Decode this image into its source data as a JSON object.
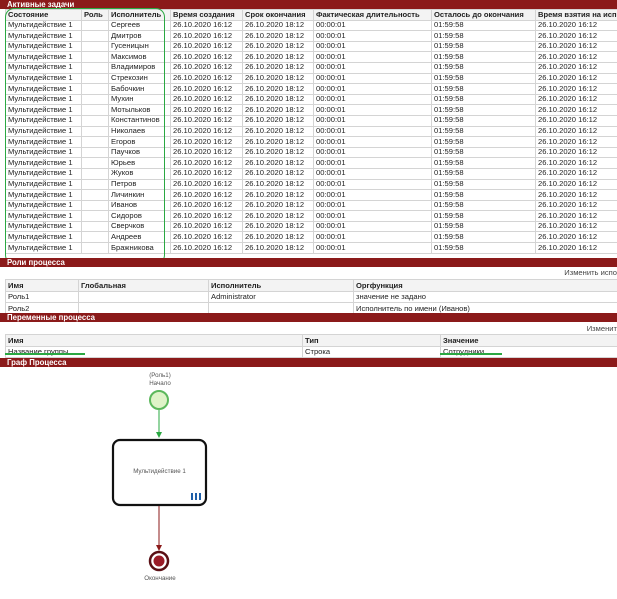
{
  "tasks": {
    "section_title": "Активные задачи",
    "headers": [
      "Состояние",
      "Роль",
      "Исполнитель",
      "Время создания",
      "Срок окончания",
      "Фактическая длительность",
      "Осталось до окончания",
      "Время взятия на испол"
    ],
    "rows": [
      [
        "Мультидействие 1",
        "",
        "Сергеев",
        "26.10.2020 16:12",
        "26.10.2020 18:12",
        "00:00:01",
        "01:59:58",
        "26.10.2020 16:12"
      ],
      [
        "Мультидействие 1",
        "",
        "Дмитров",
        "26.10.2020 16:12",
        "26.10.2020 18:12",
        "00:00:01",
        "01:59:58",
        "26.10.2020 16:12"
      ],
      [
        "Мультидействие 1",
        "",
        "Гусеницын",
        "26.10.2020 16:12",
        "26.10.2020 18:12",
        "00:00:01",
        "01:59:58",
        "26.10.2020 16:12"
      ],
      [
        "Мультидействие 1",
        "",
        "Максимов",
        "26.10.2020 16:12",
        "26.10.2020 18:12",
        "00:00:01",
        "01:59:58",
        "26.10.2020 16:12"
      ],
      [
        "Мультидействие 1",
        "",
        "Владимиров",
        "26.10.2020 16:12",
        "26.10.2020 18:12",
        "00:00:01",
        "01:59:58",
        "26.10.2020 16:12"
      ],
      [
        "Мультидействие 1",
        "",
        "Стрекозин",
        "26.10.2020 16:12",
        "26.10.2020 18:12",
        "00:00:01",
        "01:59:58",
        "26.10.2020 16:12"
      ],
      [
        "Мультидействие 1",
        "",
        "Бабочкин",
        "26.10.2020 16:12",
        "26.10.2020 18:12",
        "00:00:01",
        "01:59:58",
        "26.10.2020 16:12"
      ],
      [
        "Мультидействие 1",
        "",
        "Мухин",
        "26.10.2020 16:12",
        "26.10.2020 18:12",
        "00:00:01",
        "01:59:58",
        "26.10.2020 16:12"
      ],
      [
        "Мультидействие 1",
        "",
        "Мотыльков",
        "26.10.2020 16:12",
        "26.10.2020 18:12",
        "00:00:01",
        "01:59:58",
        "26.10.2020 16:12"
      ],
      [
        "Мультидействие 1",
        "",
        "Константинов",
        "26.10.2020 16:12",
        "26.10.2020 18:12",
        "00:00:01",
        "01:59:58",
        "26.10.2020 16:12"
      ],
      [
        "Мультидействие 1",
        "",
        "Николаев",
        "26.10.2020 16:12",
        "26.10.2020 18:12",
        "00:00:01",
        "01:59:58",
        "26.10.2020 16:12"
      ],
      [
        "Мультидействие 1",
        "",
        "Егоров",
        "26.10.2020 16:12",
        "26.10.2020 18:12",
        "00:00:01",
        "01:59:58",
        "26.10.2020 16:12"
      ],
      [
        "Мультидействие 1",
        "",
        "Паучков",
        "26.10.2020 16:12",
        "26.10.2020 18:12",
        "00:00:01",
        "01:59:58",
        "26.10.2020 16:12"
      ],
      [
        "Мультидействие 1",
        "",
        "Юрьев",
        "26.10.2020 16:12",
        "26.10.2020 18:12",
        "00:00:01",
        "01:59:58",
        "26.10.2020 16:12"
      ],
      [
        "Мультидействие 1",
        "",
        "Жуков",
        "26.10.2020 16:12",
        "26.10.2020 18:12",
        "00:00:01",
        "01:59:58",
        "26.10.2020 16:12"
      ],
      [
        "Мультидействие 1",
        "",
        "Петров",
        "26.10.2020 16:12",
        "26.10.2020 18:12",
        "00:00:01",
        "01:59:58",
        "26.10.2020 16:12"
      ],
      [
        "Мультидействие 1",
        "",
        "Личинкин",
        "26.10.2020 16:12",
        "26.10.2020 18:12",
        "00:00:01",
        "01:59:58",
        "26.10.2020 16:12"
      ],
      [
        "Мультидействие 1",
        "",
        "Иванов",
        "26.10.2020 16:12",
        "26.10.2020 18:12",
        "00:00:01",
        "01:59:58",
        "26.10.2020 16:12"
      ],
      [
        "Мультидействие 1",
        "",
        "Сидоров",
        "26.10.2020 16:12",
        "26.10.2020 18:12",
        "00:00:01",
        "01:59:58",
        "26.10.2020 16:12"
      ],
      [
        "Мультидействие 1",
        "",
        "Сверчков",
        "26.10.2020 16:12",
        "26.10.2020 18:12",
        "00:00:01",
        "01:59:58",
        "26.10.2020 16:12"
      ],
      [
        "Мультидействие 1",
        "",
        "Андреев",
        "26.10.2020 16:12",
        "26.10.2020 18:12",
        "00:00:01",
        "01:59:58",
        "26.10.2020 16:12"
      ],
      [
        "Мультидействие 1",
        "",
        "Бражникова",
        "26.10.2020 16:12",
        "26.10.2020 18:12",
        "00:00:01",
        "01:59:58",
        "26.10.2020 16:12"
      ]
    ]
  },
  "roles": {
    "section_title": "Роли процесса",
    "edit_link": "Изменить испо",
    "headers": [
      "Имя",
      "Глобальная",
      "Исполнитель",
      "Оргфункция"
    ],
    "rows": [
      [
        "Роль1",
        "",
        "Administrator",
        "значение не задано"
      ],
      [
        "Роль2",
        "",
        "",
        "Исполнитель по имени (Иванов)"
      ]
    ]
  },
  "variables": {
    "section_title": "Переменные процесса",
    "edit_link": "Изменит",
    "headers": [
      "Имя",
      "Тип",
      "Значение"
    ],
    "rows": [
      [
        "Название группы",
        "Строка",
        "Сотрудники"
      ]
    ]
  },
  "graph": {
    "section_title": "Граф Процесса",
    "start_role_label": "(Роль1)",
    "start_label": "Начало",
    "task_label": "Мультидействие 1",
    "end_label": "Окончание",
    "colors": {
      "start": "#5cb85c",
      "end": "#8b1a1a",
      "task_border": "#111111"
    }
  },
  "colors": {
    "section_bar": "#8b1a1a",
    "highlight": "#2aa842"
  }
}
